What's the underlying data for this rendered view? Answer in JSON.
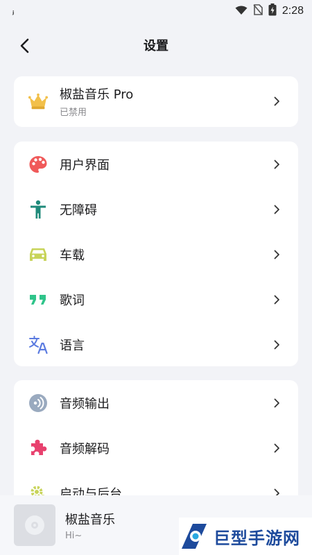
{
  "status": {
    "left_indicator": "ⱼ",
    "time": "2:28"
  },
  "header": {
    "title": "设置"
  },
  "pro": {
    "title": "椒盐音乐 Pro",
    "subtitle": "已禁用"
  },
  "group1": [
    {
      "label": "用户界面",
      "icon": "palette-icon",
      "color": "#f05a5a"
    },
    {
      "label": "无障碍",
      "icon": "accessibility-icon",
      "color": "#1f8a7a"
    },
    {
      "label": "车载",
      "icon": "car-icon",
      "color": "#c8d45a"
    },
    {
      "label": "歌词",
      "icon": "quote-icon",
      "color": "#2fc48a"
    },
    {
      "label": "语言",
      "icon": "translate-icon",
      "color": "#5b7be0"
    }
  ],
  "group2": [
    {
      "label": "音频输出",
      "icon": "audio-output-icon",
      "color": "#9aaabf"
    },
    {
      "label": "音频解码",
      "icon": "puzzle-icon",
      "color": "#e8416e"
    },
    {
      "label": "启动与后台",
      "icon": "gear-icon",
      "color": "#c8d45a"
    }
  ],
  "player": {
    "title": "椒盐音乐",
    "subtitle": "Hi~"
  },
  "watermark": {
    "text": "巨型手游网"
  }
}
